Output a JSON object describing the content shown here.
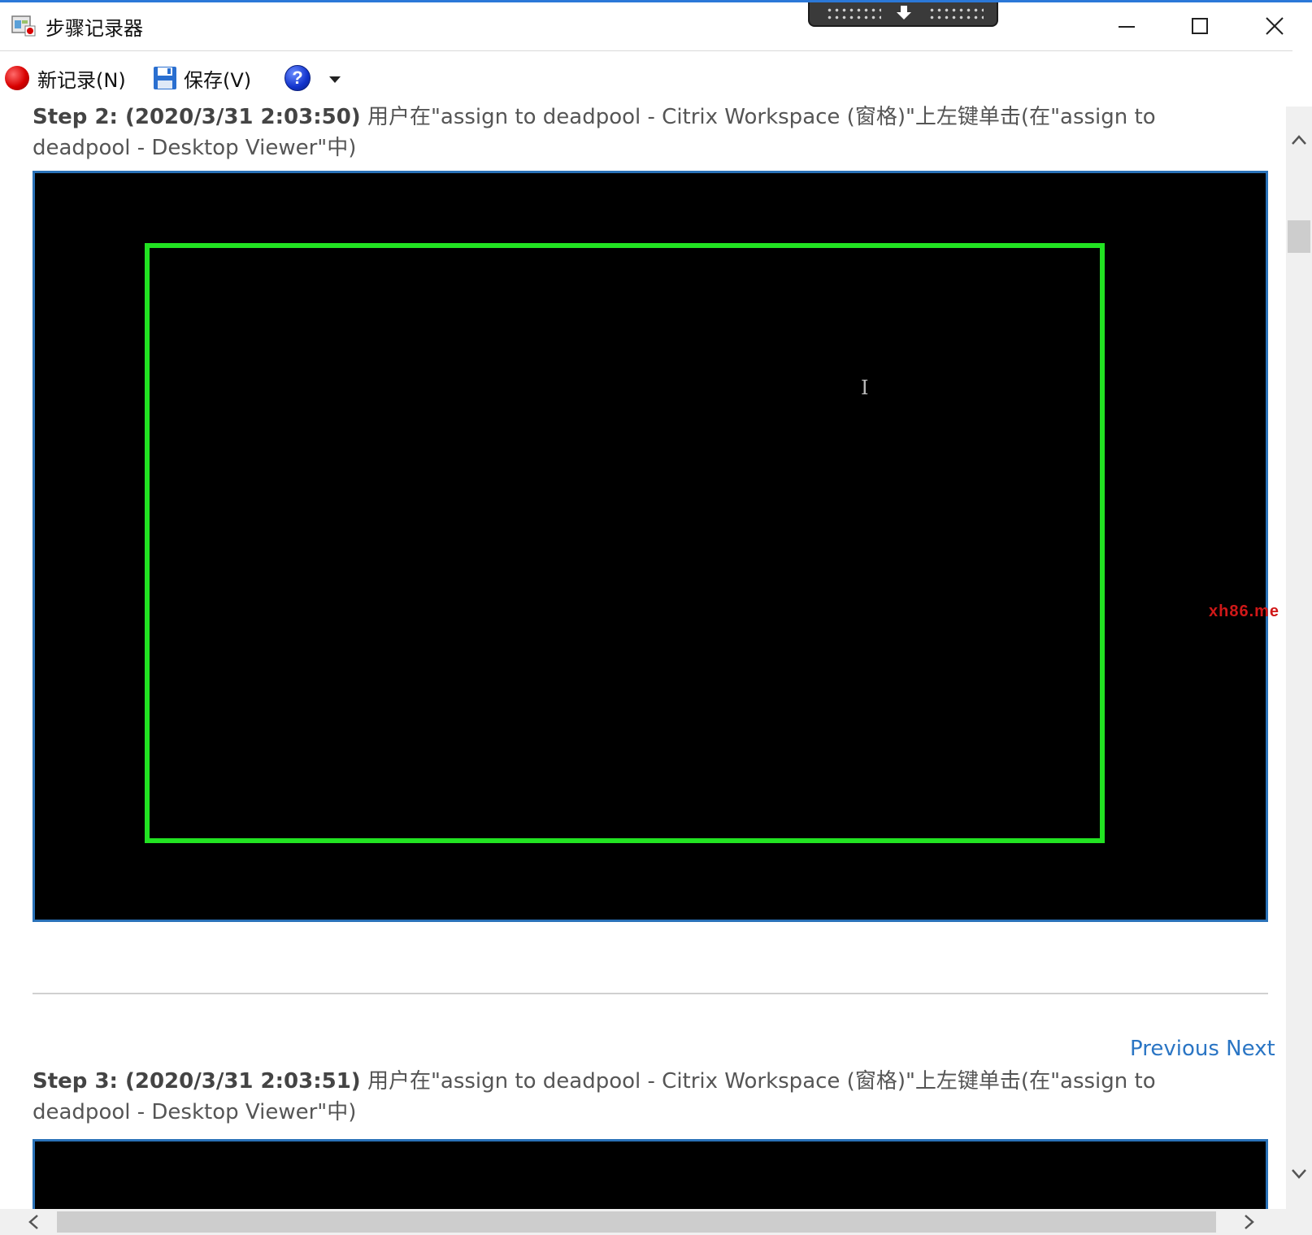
{
  "window": {
    "title": "步骤记录器"
  },
  "toolbar": {
    "new_record": "新记录(N)",
    "save": "保存(V)",
    "help": "?"
  },
  "steps": [
    {
      "label": "Step 2: (2020/3/31 2:03:50)",
      "description": "用户在\"assign to deadpool - Citrix Workspace (窗格)\"上左键单击(在\"assign to deadpool - Desktop Viewer\"中)"
    },
    {
      "label": "Step 3: (2020/3/31 2:03:51)",
      "description": "用户在\"assign to deadpool - Citrix Workspace (窗格)\"上左键单击(在\"assign to deadpool - Desktop Viewer\"中)"
    }
  ],
  "nav": {
    "previous": "Previous",
    "next": "Next"
  },
  "watermark": "xh86.me",
  "colors": {
    "accent": "#2b78d8",
    "link": "#2a75c4",
    "highlight": "#22e322",
    "record": "#d80000"
  }
}
